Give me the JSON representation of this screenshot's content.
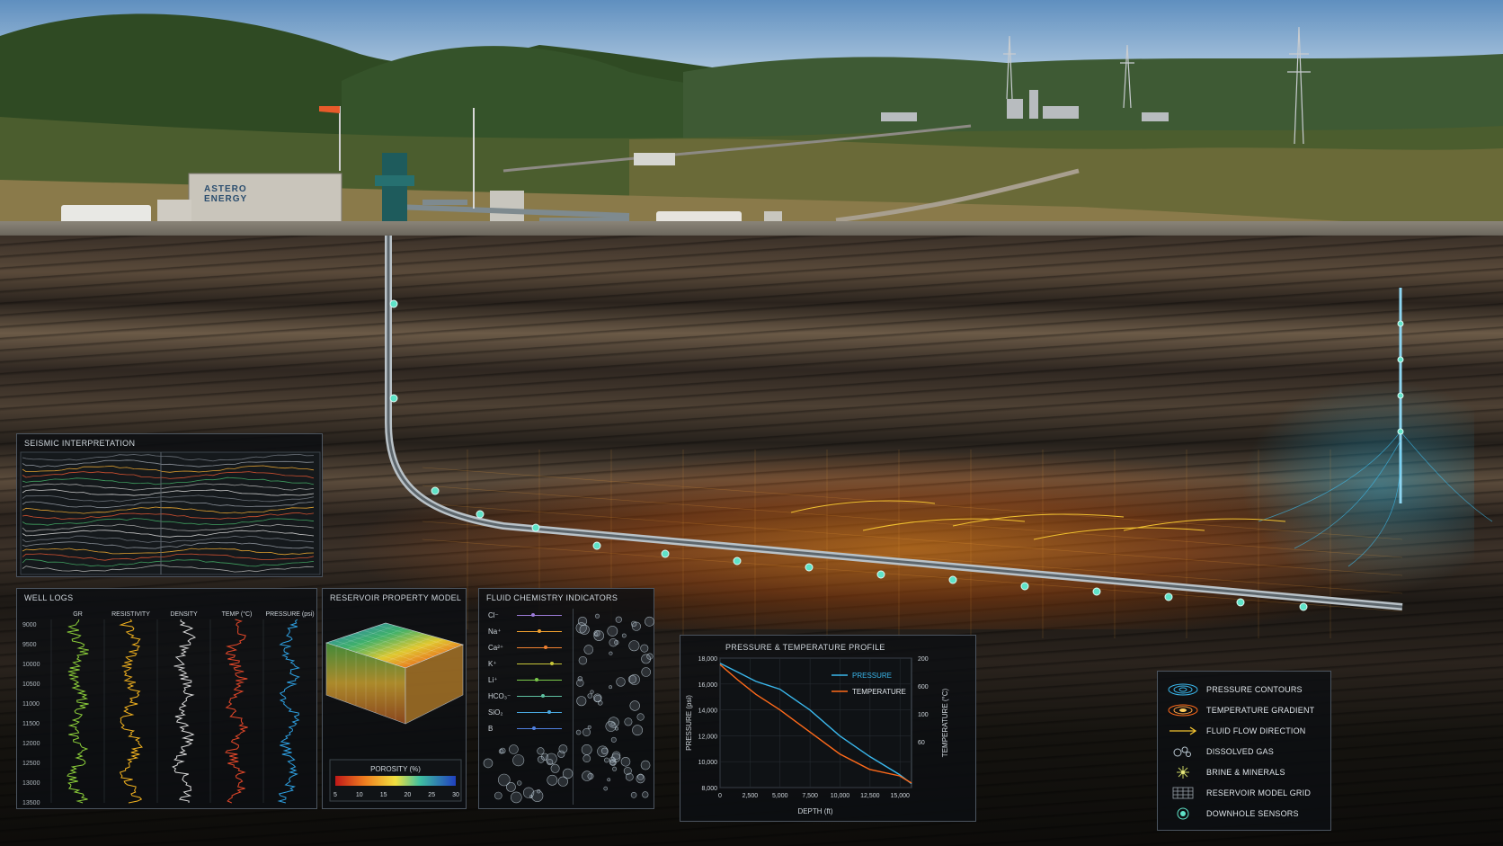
{
  "company": {
    "name_line1": "ASTERO",
    "name_line2": "ENERGY"
  },
  "colors": {
    "pressure": "#3ab7ec",
    "temperature": "#ff6a1a",
    "sensor": "#5fe3c8",
    "flow": "#f2c230",
    "panel_border": "#4c5560"
  },
  "seismic": {
    "title": "SEISMIC INTERPRETATION"
  },
  "well_logs": {
    "title": "WELL LOGS",
    "tracks": [
      "GR",
      "RESISTIVITY",
      "DENSITY",
      "TEMP (°C)",
      "PRESSURE (psi)"
    ],
    "track_colors": [
      "#8ccf3a",
      "#f2b21f",
      "#d9d9d9",
      "#e5482a",
      "#2e9fe0"
    ],
    "depths": [
      "9000",
      "9500",
      "10000",
      "10500",
      "11000",
      "11500",
      "12000",
      "12500",
      "13000",
      "13500"
    ]
  },
  "reservoir": {
    "title": "RESERVOIR PROPERTY MODEL",
    "colorbar_title": "POROSITY (%)",
    "colorbar_ticks": [
      "5",
      "10",
      "15",
      "20",
      "25",
      "30"
    ]
  },
  "fluid": {
    "title": "FLUID CHEMISTRY INDICATORS",
    "species": [
      {
        "label": "Cl⁻",
        "color": "#9c7bd8"
      },
      {
        "label": "Na⁺",
        "color": "#f0a030"
      },
      {
        "label": "Ca²⁺",
        "color": "#f08030"
      },
      {
        "label": "K⁺",
        "color": "#c9c83a"
      },
      {
        "label": "Li⁺",
        "color": "#7ac94a"
      },
      {
        "label": "HCO₃⁻",
        "color": "#5ec0a0"
      },
      {
        "label": "SiO₂",
        "color": "#4aa8e0"
      },
      {
        "label": "B",
        "color": "#5080e0"
      }
    ]
  },
  "pt_profile": {
    "title": "PRESSURE & TEMPERATURE PROFILE",
    "xlabel": "DEPTH (ft)",
    "ylabel_left": "PRESSURE (psi)",
    "ylabel_right": "TEMPERATURE (°C)",
    "x_ticks": [
      "0",
      "2,500",
      "5,000",
      "7,500",
      "10,000",
      "12,500",
      "15,000"
    ],
    "y_left_ticks": [
      "18,000",
      "16,000",
      "14,000",
      "12,000",
      "10,000",
      "8,000"
    ],
    "y_right_ticks": [
      "200",
      "600",
      "100",
      "60"
    ],
    "legend": [
      "PRESSURE",
      "TEMPERATURE"
    ]
  },
  "chart_data": {
    "type": "line",
    "title": "PRESSURE & TEMPERATURE PROFILE",
    "xlabel": "DEPTH (ft)",
    "ylabel": "PRESSURE (psi)",
    "xlim": [
      0,
      16000
    ],
    "ylim": [
      8000,
      18000
    ],
    "series": [
      {
        "name": "PRESSURE",
        "x": [
          0,
          1500,
          3000,
          5000,
          7500,
          10000,
          12500,
          15000,
          16000
        ],
        "values": [
          17600,
          16900,
          16200,
          15600,
          14000,
          12000,
          10400,
          9000,
          8300
        ]
      },
      {
        "name": "TEMPERATURE",
        "x": [
          0,
          1500,
          3000,
          5000,
          7500,
          10000,
          12500,
          15000,
          16000
        ],
        "values": [
          17500,
          16300,
          15200,
          14000,
          12300,
          10600,
          9400,
          8900,
          8350
        ]
      }
    ]
  },
  "legend": {
    "items": [
      {
        "label": "PRESSURE CONTOURS",
        "icon": "pressure-contours-icon"
      },
      {
        "label": "TEMPERATURE GRADIENT",
        "icon": "temperature-gradient-icon"
      },
      {
        "label": "FLUID FLOW DIRECTION",
        "icon": "flow-arrow-icon"
      },
      {
        "label": "DISSOLVED GAS",
        "icon": "bubbles-icon"
      },
      {
        "label": "BRINE & MINERALS",
        "icon": "mineral-icon"
      },
      {
        "label": "RESERVOIR MODEL GRID",
        "icon": "grid-icon"
      },
      {
        "label": "DOWNHOLE SENSORS",
        "icon": "sensor-icon"
      }
    ]
  }
}
